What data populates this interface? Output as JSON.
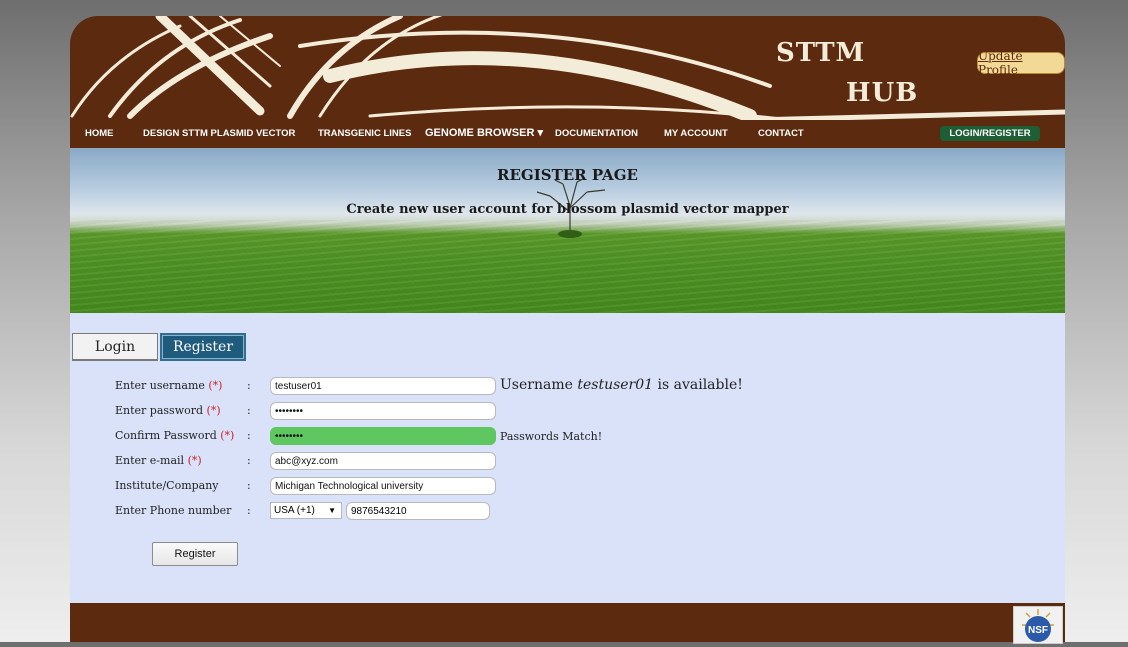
{
  "header": {
    "brand_line1": "STTM",
    "brand_line2": "HUB",
    "update_profile": "Update Profile"
  },
  "nav": {
    "items": [
      {
        "label": "HOME"
      },
      {
        "label": "DESIGN STTM PLASMID VECTOR"
      },
      {
        "label": "TRANSGENIC LINES"
      },
      {
        "label": "GENOME BROWSER ▾"
      },
      {
        "label": "DOCUMENTATION"
      },
      {
        "label": "MY ACCOUNT"
      },
      {
        "label": "CONTACT"
      }
    ],
    "login_register": "LOGIN/REGISTER"
  },
  "banner": {
    "title": "REGISTER PAGE",
    "subtitle": "Create new user account for blossom plasmid vector mapper"
  },
  "tabs": {
    "login": "Login",
    "register": "Register"
  },
  "form": {
    "username_label": "Enter username",
    "password_label": "Enter password",
    "confirm_label": "Confirm Password",
    "email_label": "Enter e-mail",
    "institute_label": "Institute/Company",
    "phone_label": "Enter Phone number",
    "required_mark": "(*)",
    "colon": ":",
    "username_value": "testuser01",
    "password_value": "••••••••",
    "confirm_value": "••••••••",
    "email_value": "abc@xyz.com",
    "institute_value": "Michigan Technological university",
    "country_value": "USA (+1)",
    "phone_value": "9876543210",
    "username_msg_prefix": "Username ",
    "username_msg_name": "testuser01",
    "username_msg_suffix": " is available!",
    "password_match_msg": "Passwords Match!",
    "submit_label": "Register"
  },
  "footer": {
    "logo_text": "NSF"
  },
  "colors": {
    "brown": "#5c2a0e",
    "cream": "#f3ecd9",
    "content_bg": "#d9e2f8",
    "match_green": "#5fc75f",
    "tab_active": "#1f5b7c"
  }
}
